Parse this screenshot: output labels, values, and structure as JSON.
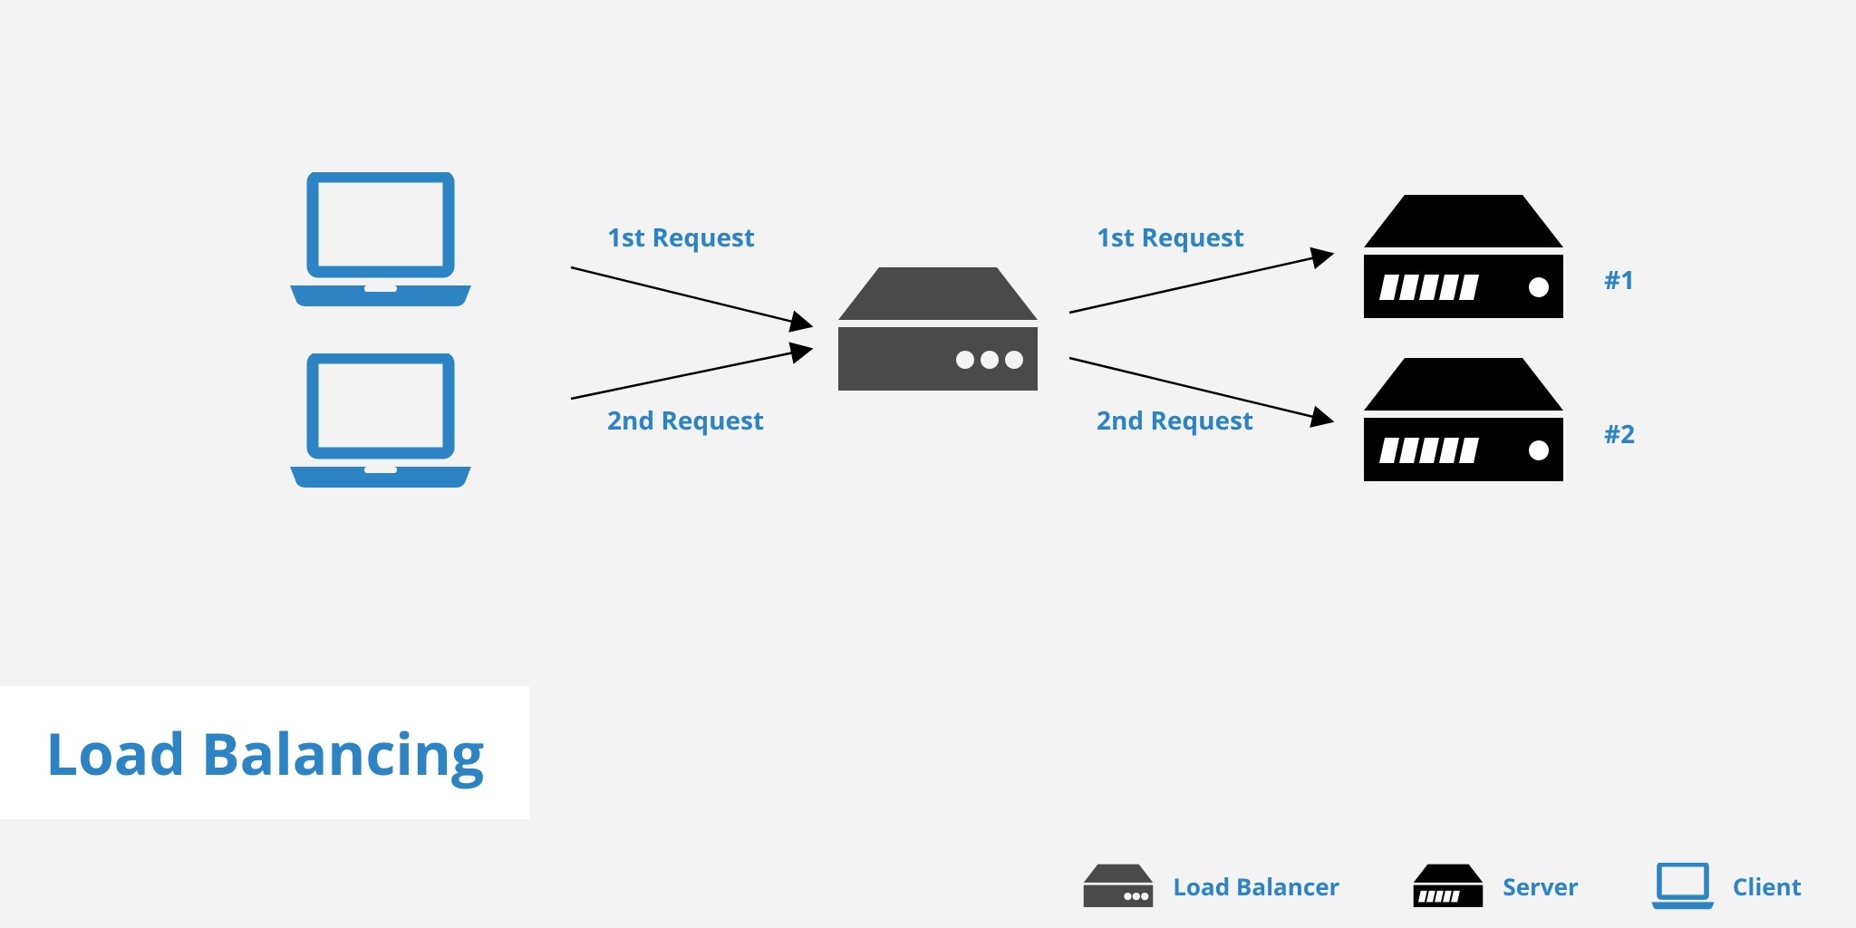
{
  "title": "Load Balancing",
  "labels": {
    "req1_left": "1st Request",
    "req2_left": "2nd Request",
    "req1_right": "1st Request",
    "req2_right": "2nd Request",
    "server1": "#1",
    "server2": "#2"
  },
  "legend": {
    "load_balancer": "Load Balancer",
    "server": "Server",
    "client": "Client"
  },
  "colors": {
    "accent": "#2d84c4",
    "balancer": "#4a4a4a",
    "server": "#000000",
    "bg": "#f3f3f3"
  }
}
